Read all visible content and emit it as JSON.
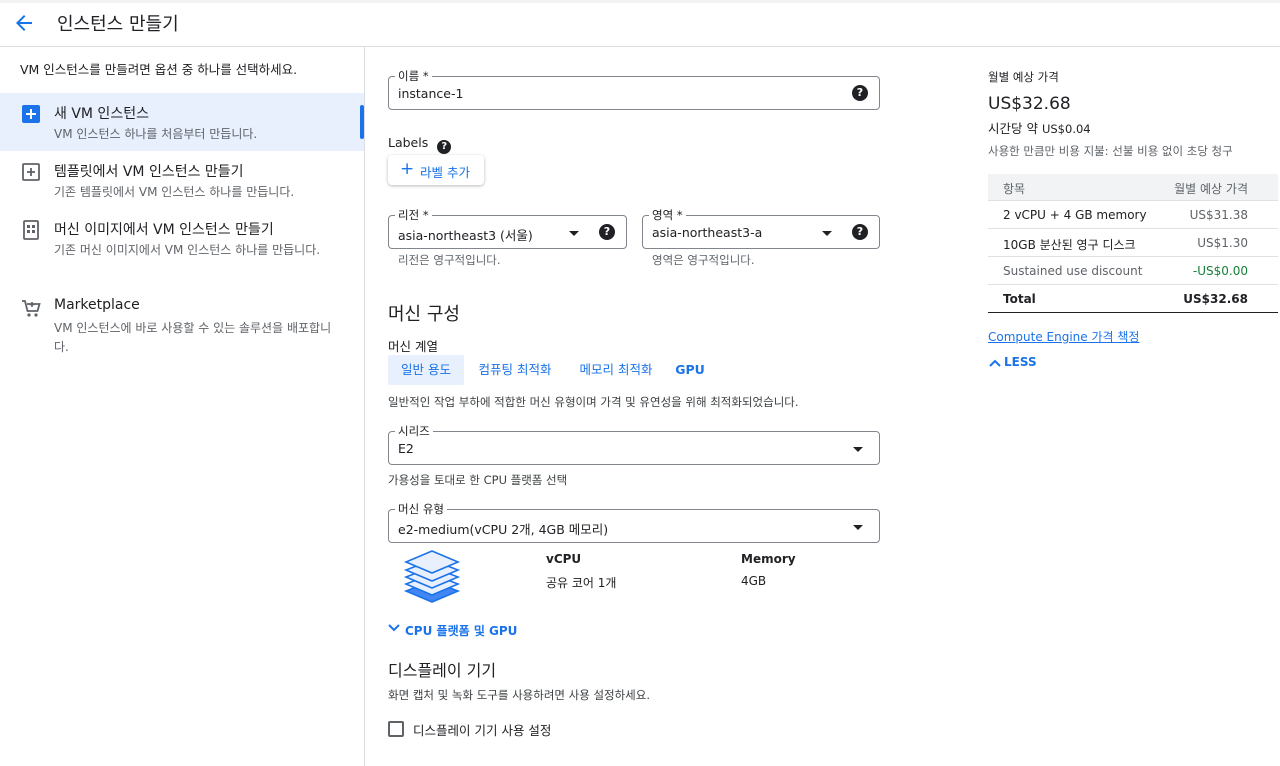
{
  "header": {
    "title": "인스턴스 만들기"
  },
  "sidebar": {
    "intro": "VM 인스턴스를 만들려면 옵션 중 하나를 선택하세요.",
    "options": [
      {
        "title": "새 VM 인스턴스",
        "desc": "VM 인스턴스 하나를 처음부터 만듭니다.",
        "icon": "add-box-icon"
      },
      {
        "title": "템플릿에서 VM 인스턴스 만들기",
        "desc": "기존 템플릿에서 VM 인스턴스 하나를 만듭니다.",
        "icon": "template-icon"
      },
      {
        "title": "머신 이미지에서 VM 인스턴스 만들기",
        "desc": "기존 머신 이미지에서 VM 인스턴스 하나를 만듭니다.",
        "icon": "machine-image-icon"
      },
      {
        "title": "Marketplace",
        "desc": "VM 인스턴스에 바로 사용할 수 있는 솔루션을 배포합니다.",
        "icon": "cart-icon"
      }
    ]
  },
  "form": {
    "name": {
      "label": "이름 *",
      "value": "instance-1"
    },
    "labels": {
      "title": "Labels",
      "add_button": "라벨 추가"
    },
    "region": {
      "label": "리전 *",
      "value": "asia-northeast3 (서울)",
      "hint": "리전은 영구적입니다."
    },
    "zone": {
      "label": "영역 *",
      "value": "asia-northeast3-a",
      "hint": "영역은 영구적입니다."
    },
    "machine_config": {
      "title": "머신 구성",
      "family_label": "머신 계열",
      "tabs": [
        "일반 용도",
        "컴퓨팅 최적화",
        "메모리 최적화",
        "GPU"
      ],
      "tab_desc": "일반적인 작업 부하에 적합한 머신 유형이며 가격 및 유연성을 위해 최적화되었습니다.",
      "series": {
        "label": "시리즈",
        "value": "E2",
        "hint": "가용성을 토대로 한 CPU 플랫폼 선택"
      },
      "machine_type": {
        "label": "머신 유형",
        "value": "e2-medium(vCPU 2개, 4GB 메모리)"
      },
      "specs": {
        "vcpu_header": "vCPU",
        "vcpu_value": "공유 코어 1개",
        "memory_header": "Memory",
        "memory_value": "4GB"
      },
      "expander": "CPU 플랫폼 및 GPU"
    },
    "display": {
      "title": "디스플레이 기기",
      "desc": "화면 캡처 및 녹화 도구를 사용하려면 사용 설정하세요.",
      "checkbox_label": "디스플레이 기기 사용 설정"
    }
  },
  "pricing": {
    "title": "월별 예상 가격",
    "monthly": "US$32.68",
    "hourly_prefix": "시간당 약",
    "hourly_value": "US$0.04",
    "note": "사용한 만큼만 비용 지불: 선불 비용 없이 초당 청구",
    "table": {
      "headers": [
        "항목",
        "월별 예상 가격"
      ],
      "rows": [
        {
          "item": "2 vCPU + 4 GB memory",
          "price": "US$31.38"
        },
        {
          "item": "10GB 분산된 영구 디스크",
          "price": "US$1.30"
        },
        {
          "item": "Sustained use discount",
          "price": "-US$0.00"
        }
      ],
      "total_label": "Total",
      "total_value": "US$32.68"
    },
    "link": "Compute Engine 가격 책정",
    "less": "LESS"
  },
  "colors": {
    "accent": "#1a73e8",
    "selected_bg": "#e8f0fe",
    "discount": "#188038"
  }
}
